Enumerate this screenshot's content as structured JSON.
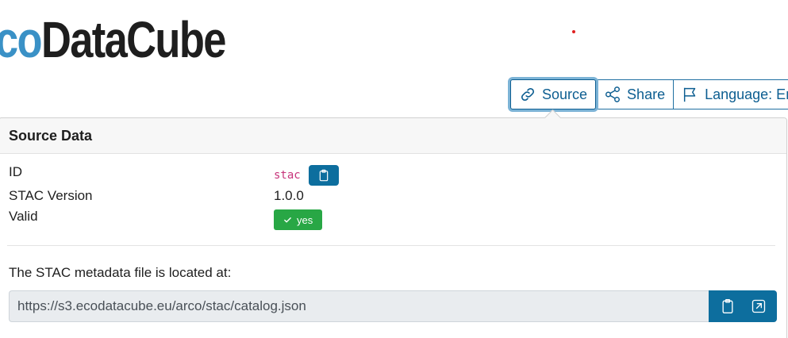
{
  "logo": {
    "part1": "co",
    "part2": "DataCube"
  },
  "toolbar": {
    "source_label": "Source",
    "share_label": "Share",
    "language_label": "Language: Engli"
  },
  "panel": {
    "title": "Source Data",
    "rows": [
      {
        "label": "ID",
        "value": "stac"
      },
      {
        "label": "STAC Version",
        "value": "1.0.0"
      },
      {
        "label": "Valid",
        "value": "yes"
      }
    ],
    "located_text": "The STAC metadata file is located at:",
    "url": "https://s3.ecodatacube.eu/arco/stac/catalog.json"
  },
  "colors": {
    "brand_blue": "#3a91c6",
    "button_blue": "#0d6e9e",
    "valid_green": "#28a745",
    "code_pink": "#c7337a"
  },
  "icons": [
    "link-icon",
    "share-icon",
    "flag-icon",
    "clipboard-icon",
    "check-icon",
    "external-link-icon"
  ]
}
